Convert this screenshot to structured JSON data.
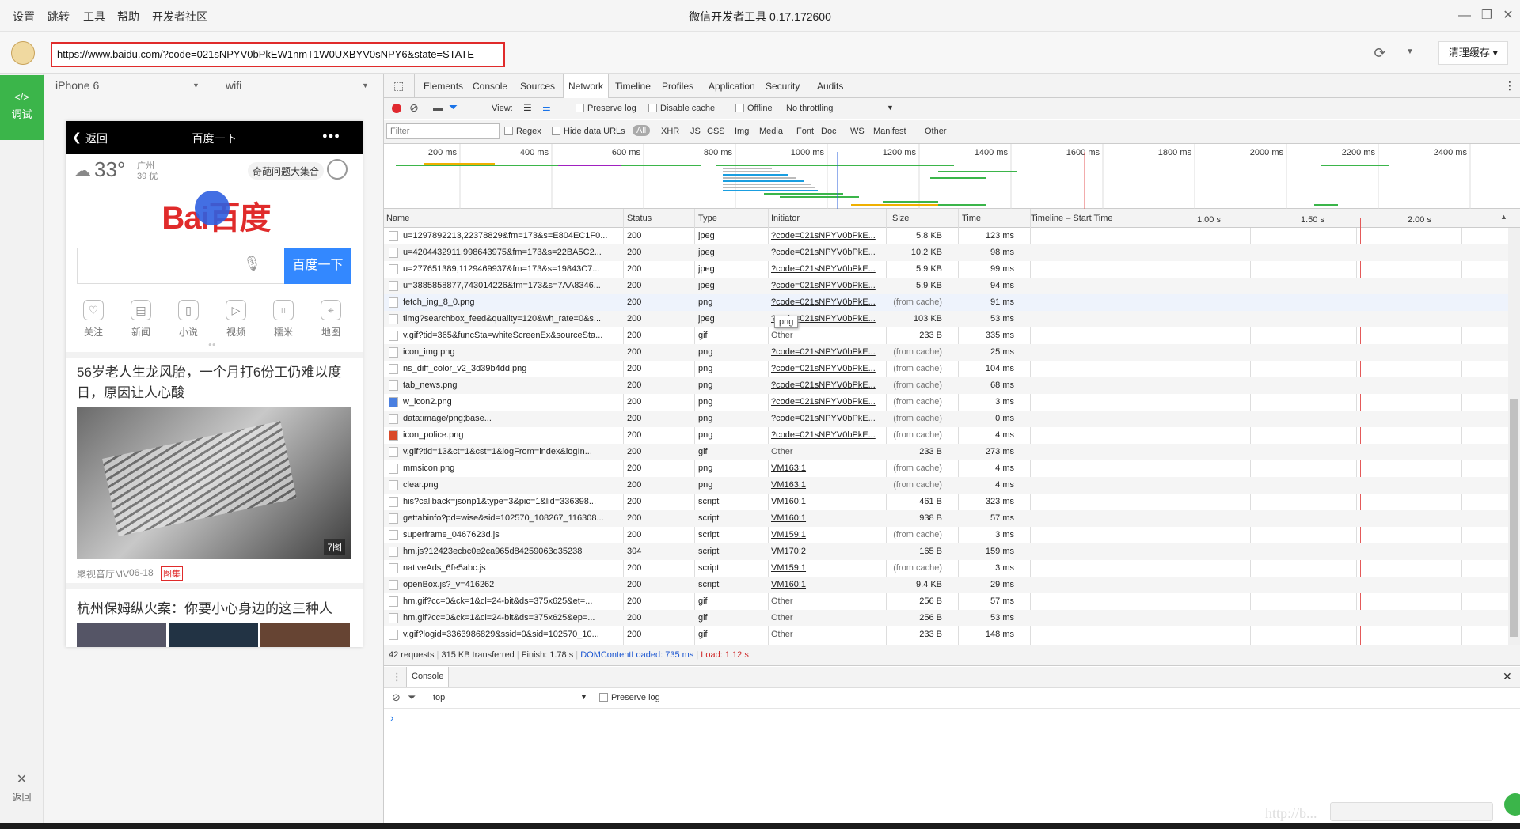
{
  "titlebar": {
    "menus": [
      "设置",
      "跳转",
      "工具",
      "帮助",
      "开发者社区"
    ],
    "title": "微信开发者工具 0.17.172600"
  },
  "urlbar": {
    "url": "https://www.baidu.com/?code=021sNPYV0bPkEW1nmT1W0UXBYV0sNPY6&state=STATE",
    "clear_cache_label": "清理缓存 ▾"
  },
  "leftbar": {
    "debug_label": "调试",
    "back_label": "返回"
  },
  "simulator": {
    "device": "iPhone 6",
    "network": "wifi",
    "nav_back": "返回",
    "nav_title": "百度一下",
    "nav_more": "●●●",
    "weather_temp": "33°",
    "weather_city": "广州",
    "weather_aqi": "39 优",
    "promo_pill": "奇葩问题大集合",
    "logo_text": "Bai百度",
    "search_button": "百度一下",
    "quick_links": [
      "关注",
      "新闻",
      "小说",
      "视频",
      "糯米",
      "地图"
    ],
    "news1_title": "56岁老人生龙风胎，一个月打6份工仍难以度日，原因让人心酸",
    "news1_badge": "7图",
    "news1_source": "聚视音厅MV",
    "news1_date": "06-18",
    "news1_tag": "图集",
    "news2_title": "杭州保姆纵火案：你要小心身边的这三种人"
  },
  "devtools": {
    "tabs": [
      "Elements",
      "Console",
      "Sources",
      "Network",
      "Timeline",
      "Profiles",
      "Application",
      "Security",
      "Audits"
    ],
    "active_tab": "Network",
    "toolbar": {
      "view_label": "View:",
      "preserve_log": "Preserve log",
      "disable_cache": "Disable cache",
      "offline": "Offline",
      "throttling": "No throttling"
    },
    "filter": {
      "placeholder": "Filter",
      "regex": "Regex",
      "hide_data_urls": "Hide data URLs",
      "types": [
        "All",
        "XHR",
        "JS",
        "CSS",
        "Img",
        "Media",
        "Font",
        "Doc",
        "WS",
        "Manifest",
        "Other"
      ]
    },
    "overview_ticks": [
      "200 ms",
      "400 ms",
      "600 ms",
      "800 ms",
      "1000 ms",
      "1200 ms",
      "1400 ms",
      "1600 ms",
      "1800 ms",
      "2000 ms",
      "2200 ms",
      "2400 ms"
    ],
    "columns": [
      "Name",
      "Status",
      "Type",
      "Initiator",
      "Size",
      "Time",
      "Timeline – Start Time"
    ],
    "timeline_ticks": [
      "1.00 s",
      "1.50 s",
      "2.00 s"
    ],
    "tooltip": "png",
    "rows": [
      {
        "name": "u=1297892213,22378829&fm=173&s=E804EC1F0...",
        "status": "200",
        "type": "jpeg",
        "initiator": "?code=021sNPYV0bPkE...",
        "size": "5.8 KB",
        "time": "123 ms",
        "icon": "img"
      },
      {
        "name": "u=4204432911,998643975&fm=173&s=22BA5C2...",
        "status": "200",
        "type": "jpeg",
        "initiator": "?code=021sNPYV0bPkE...",
        "size": "10.2 KB",
        "time": "98 ms",
        "icon": "img"
      },
      {
        "name": "u=277651389,1129469937&fm=173&s=19843C7...",
        "status": "200",
        "type": "jpeg",
        "initiator": "?code=021sNPYV0bPkE...",
        "size": "5.9 KB",
        "time": "99 ms",
        "icon": "img"
      },
      {
        "name": "u=3885858877,743014226&fm=173&s=7AA8346...",
        "status": "200",
        "type": "jpeg",
        "initiator": "?code=021sNPYV0bPkE...",
        "size": "5.9 KB",
        "time": "94 ms",
        "icon": "img"
      },
      {
        "name": "fetch_ing_8_0.png",
        "status": "200",
        "type": "png",
        "initiator": "?code=021sNPYV0bPkE...",
        "size": "(from cache)",
        "time": "91 ms",
        "icon": "img"
      },
      {
        "name": "timg?searchbox_feed&quality=120&wh_rate=0&s...",
        "status": "200",
        "type": "jpeg",
        "initiator": "?code=021sNPYV0bPkE...",
        "size": "103 KB",
        "time": "53 ms",
        "icon": "img"
      },
      {
        "name": "v.gif?tid=365&funcSta=whiteScreenEx&sourceSta...",
        "status": "200",
        "type": "gif",
        "initiator": "Other",
        "size": "233 B",
        "time": "335 ms",
        "icon": "img"
      },
      {
        "name": "icon_img.png",
        "status": "200",
        "type": "png",
        "initiator": "?code=021sNPYV0bPkE...",
        "size": "(from cache)",
        "time": "25 ms",
        "icon": "doc"
      },
      {
        "name": "ns_diff_color_v2_3d39b4dd.png",
        "status": "200",
        "type": "png",
        "initiator": "?code=021sNPYV0bPkE...",
        "size": "(from cache)",
        "time": "104 ms",
        "icon": "doc"
      },
      {
        "name": "tab_news.png",
        "status": "200",
        "type": "png",
        "initiator": "?code=021sNPYV0bPkE...",
        "size": "(from cache)",
        "time": "68 ms",
        "icon": "doc"
      },
      {
        "name": "w_icon2.png",
        "status": "200",
        "type": "png",
        "initiator": "?code=021sNPYV0bPkE...",
        "size": "(from cache)",
        "time": "3 ms",
        "icon": "blue"
      },
      {
        "name": "data:image/png;base...",
        "status": "200",
        "type": "png",
        "initiator": "?code=021sNPYV0bPkE...",
        "size": "(from cache)",
        "time": "0 ms",
        "icon": "doc"
      },
      {
        "name": "icon_police.png",
        "status": "200",
        "type": "png",
        "initiator": "?code=021sNPYV0bPkE...",
        "size": "(from cache)",
        "time": "4 ms",
        "icon": "red"
      },
      {
        "name": "v.gif?tid=13&ct=1&cst=1&logFrom=index&logIn...",
        "status": "200",
        "type": "gif",
        "initiator": "Other",
        "size": "233 B",
        "time": "273 ms",
        "icon": "img"
      },
      {
        "name": "mmsicon.png",
        "status": "200",
        "type": "png",
        "initiator": "VM163:1",
        "size": "(from cache)",
        "time": "4 ms",
        "icon": "img"
      },
      {
        "name": "clear.png",
        "status": "200",
        "type": "png",
        "initiator": "VM163:1",
        "size": "(from cache)",
        "time": "4 ms",
        "icon": "img"
      },
      {
        "name": "his?callback=jsonp1&type=3&pic=1&lid=336398...",
        "status": "200",
        "type": "script",
        "initiator": "VM160:1",
        "size": "461 B",
        "time": "323 ms",
        "icon": "doc"
      },
      {
        "name": "gettabinfo?pd=wise&sid=102570_108267_116308...",
        "status": "200",
        "type": "script",
        "initiator": "VM160:1",
        "size": "938 B",
        "time": "57 ms",
        "icon": "doc"
      },
      {
        "name": "superframe_0467623d.js",
        "status": "200",
        "type": "script",
        "initiator": "VM159:1",
        "size": "(from cache)",
        "time": "3 ms",
        "icon": "doc"
      },
      {
        "name": "hm.js?12423ecbc0e2ca965d84259063d35238",
        "status": "304",
        "type": "script",
        "initiator": "VM170:2",
        "size": "165 B",
        "time": "159 ms",
        "icon": "doc"
      },
      {
        "name": "nativeAds_6fe5abc.js",
        "status": "200",
        "type": "script",
        "initiator": "VM159:1",
        "size": "(from cache)",
        "time": "3 ms",
        "icon": "doc"
      },
      {
        "name": "openBox.js?_v=416262",
        "status": "200",
        "type": "script",
        "initiator": "VM160:1",
        "size": "9.4 KB",
        "time": "29 ms",
        "icon": "doc"
      },
      {
        "name": "hm.gif?cc=0&ck=1&cl=24-bit&ds=375x625&et=...",
        "status": "200",
        "type": "gif",
        "initiator": "Other",
        "size": "256 B",
        "time": "57 ms",
        "icon": "doc"
      },
      {
        "name": "hm.gif?cc=0&ck=1&cl=24-bit&ds=375x625&ep=...",
        "status": "200",
        "type": "gif",
        "initiator": "Other",
        "size": "256 B",
        "time": "53 ms",
        "icon": "doc"
      },
      {
        "name": "v.gif?logid=3363986829&ssid=0&sid=102570_10...",
        "status": "200",
        "type": "gif",
        "initiator": "Other",
        "size": "233 B",
        "time": "148 ms",
        "icon": "img"
      }
    ],
    "status": {
      "requests": "42 requests",
      "transferred": "315 KB transferred",
      "finish": "Finish: 1.78 s",
      "dcl": "DOMContentLoaded: 735 ms",
      "load": "Load: 1.12 s"
    },
    "drawer": {
      "tab": "Console",
      "context": "top",
      "preserve_log": "Preserve log",
      "prompt": "›"
    }
  },
  "watermark": "http://b..."
}
